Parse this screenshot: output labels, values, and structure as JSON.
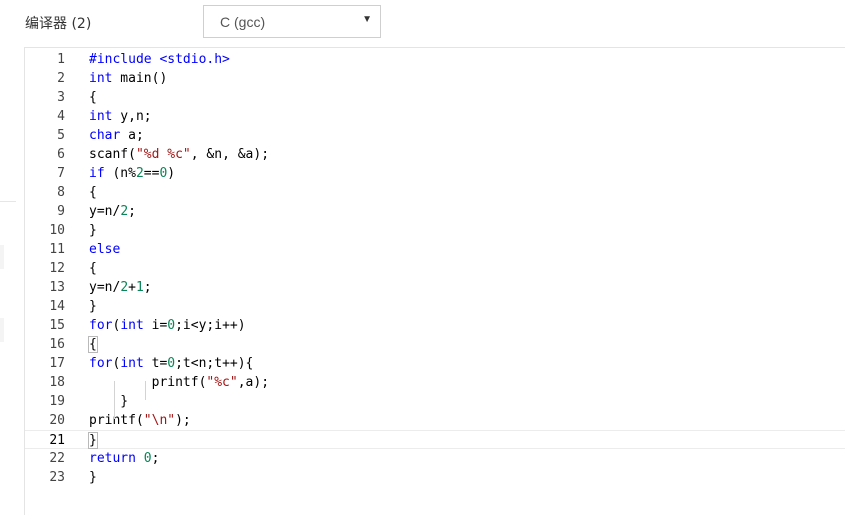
{
  "header": {
    "compiler_label": "编译器 (2)",
    "language_selected": "C (gcc)",
    "dropdown_arrow": "▼"
  },
  "editor": {
    "active_line": 21,
    "lines": [
      {
        "n": "1",
        "text": "#include <stdio.h>"
      },
      {
        "n": "2",
        "text": "int main()"
      },
      {
        "n": "3",
        "text": "{"
      },
      {
        "n": "4",
        "text": "int y,n;"
      },
      {
        "n": "5",
        "text": "char a;"
      },
      {
        "n": "6",
        "text": "scanf(\"%d %c\", &n, &a);"
      },
      {
        "n": "7",
        "text": "if (n%2==0)"
      },
      {
        "n": "8",
        "text": "{"
      },
      {
        "n": "9",
        "text": "y=n/2;"
      },
      {
        "n": "10",
        "text": "}"
      },
      {
        "n": "11",
        "text": "else"
      },
      {
        "n": "12",
        "text": "{"
      },
      {
        "n": "13",
        "text": "y=n/2+1;"
      },
      {
        "n": "14",
        "text": "}"
      },
      {
        "n": "15",
        "text": "for(int i=0;i<y;i++)"
      },
      {
        "n": "16",
        "text": "{"
      },
      {
        "n": "17",
        "text": "for(int t=0;t<n;t++){"
      },
      {
        "n": "18",
        "text": "        printf(\"%c\",a);"
      },
      {
        "n": "19",
        "text": "    }"
      },
      {
        "n": "20",
        "text": "printf(\"\\n\");"
      },
      {
        "n": "21",
        "text": "}"
      },
      {
        "n": "22",
        "text": "return 0;"
      },
      {
        "n": "23",
        "text": "}"
      }
    ]
  }
}
